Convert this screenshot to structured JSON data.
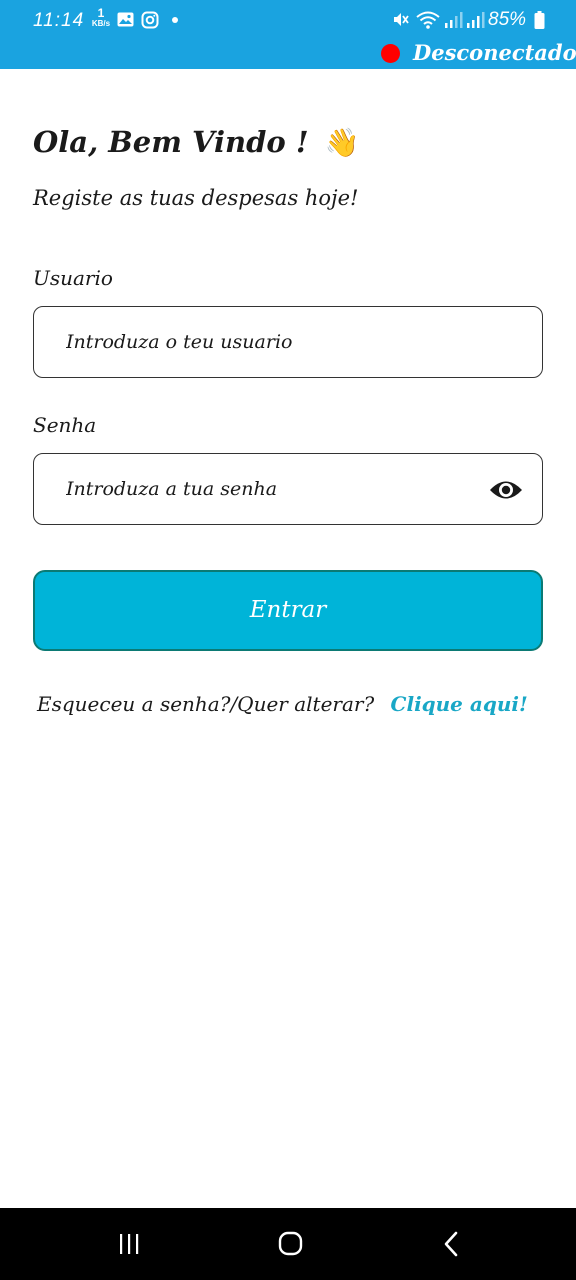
{
  "status_bar": {
    "time": "11:14",
    "net_speed_value": "1",
    "net_speed_unit": "KB/s",
    "battery_percent": "85%",
    "icons": [
      "gallery-icon",
      "instagram-icon",
      "notification-dot",
      "mute-icon",
      "wifi-icon",
      "signal-icon",
      "signal-icon",
      "battery-icon"
    ]
  },
  "connection": {
    "status_label": "Desconectado",
    "status_color": "#ff0000"
  },
  "login": {
    "title": "Ola, Bem Vindo !",
    "title_emoji": "👋",
    "subtitle": "Registe as tuas despesas hoje!",
    "username_label": "Usuario",
    "username_placeholder": "Introduza o teu usuario",
    "password_label": "Senha",
    "password_placeholder": "Introduza a tua senha",
    "submit_label": "Entrar",
    "forgot_text": "Esqueceu a senha?/Quer alterar?",
    "forgot_link": "Clique aqui!"
  },
  "theme": {
    "header_color": "#1aa3e0",
    "button_color": "#00b4d8",
    "link_color": "#19a7c6"
  },
  "nav": {
    "icons": [
      "recents-icon",
      "home-icon",
      "back-icon"
    ]
  }
}
